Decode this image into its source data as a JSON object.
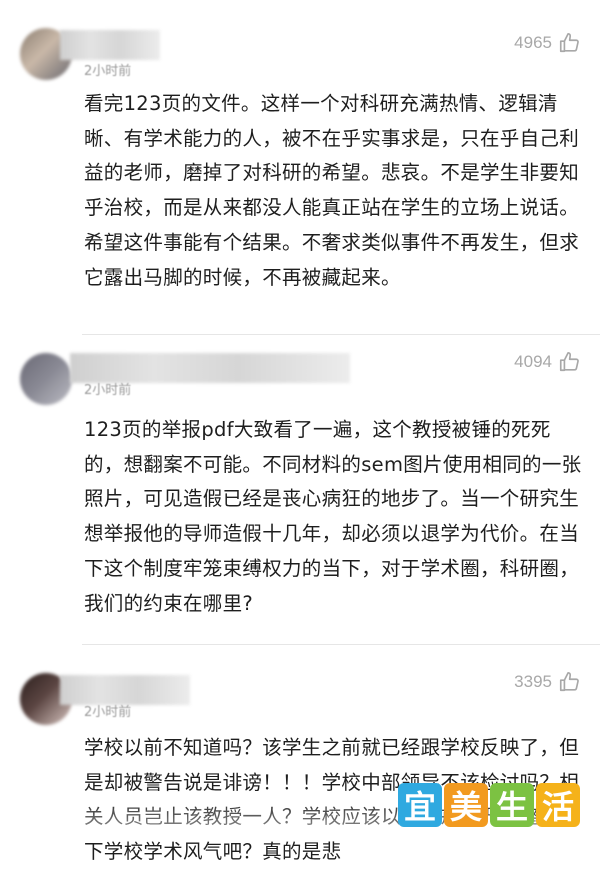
{
  "comments": [
    {
      "time": "2小时前",
      "likes": "4965",
      "text": "看完123页的文件。这样一个对科研充满热情、逻辑清晰、有学术能力的人，被不在乎实事求是，只在乎自己利益的老师，磨掉了对科研的希望。悲哀。不是学生非要知乎治校，而是从来都没人能真正站在学生的立场上说话。希望这件事能有个结果。不奢求类似事件不再发生，但求它露出马脚的时候，不再被藏起来。"
    },
    {
      "time": "2小时前",
      "likes": "4094",
      "text": "123页的举报pdf大致看了一遍，这个教授被锤的死死的，想翻案不可能。不同材料的sem图片使用相同的一张照片，可见造假已经是丧心病狂的地步了。当一个研究生想举报他的导师造假十几年，却必须以退学为代价。在当下这个制度牢笼束缚权力的当下，对于学术圈，科研圈，我们的约束在哪里?"
    },
    {
      "time": "2小时前",
      "likes": "3395",
      "text": "学校以前不知道吗？该学生之前就已经跟学校反映了，但是却被警告说是诽谤！！！学校中部领导不该检讨吗？相关人员岂止该教授一人？学校应该以此为戒，严肃整治一下学校学术风气吧？真的是悲"
    }
  ],
  "watermark": {
    "chars": [
      "宜",
      "美",
      "生",
      "活"
    ],
    "colors": [
      "#2fa9e0",
      "#f29a1f",
      "#7cc242",
      "#f5b21a"
    ]
  }
}
